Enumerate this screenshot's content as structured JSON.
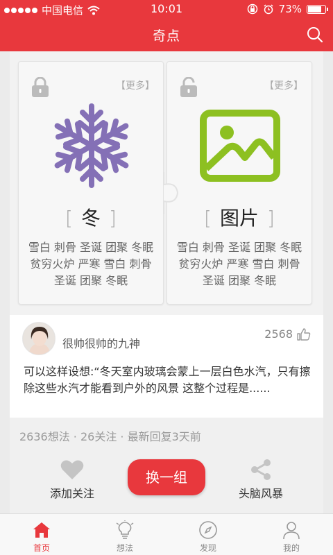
{
  "status_bar": {
    "carrier": "中国电信",
    "time": "10:01",
    "battery": "73%"
  },
  "header": {
    "title": "奇点"
  },
  "cards": [
    {
      "name": "冬",
      "more": "【更多】",
      "tags": "雪白 刺骨 圣诞 团聚 冬眠 贫穷火炉 严寒 雪白 刺骨 圣诞 团聚 冬眠",
      "icon": "snowflake-icon",
      "locked": true,
      "color": "#8470b6"
    },
    {
      "name": "图片",
      "more": "【更多】",
      "tags": "雪白 刺骨 圣诞 团聚 冬眠 贫穷火炉 严寒 雪白 刺骨 圣诞 团聚 冬眠",
      "icon": "picture-icon",
      "locked": false,
      "color": "#8dc021"
    }
  ],
  "bracket_open": "[",
  "bracket_close": "]",
  "post": {
    "author": "很帅很帅的九神",
    "likes": "2568",
    "text": "可以这样设想:“冬天室内玻璃会蒙上一层白色水汽，只有擦除这些水汽才能看到户外的风景 这整个过程是......"
  },
  "stats": {
    "line": "2636想法 · 26关注 · 最新回复3天前"
  },
  "actions": {
    "follow": "添加关注",
    "swap": "换一组",
    "brainstorm": "头脑风暴"
  },
  "tabs": [
    {
      "label": "首页",
      "icon": "home-icon",
      "active": true
    },
    {
      "label": "想法",
      "icon": "lightbulb-icon",
      "active": false
    },
    {
      "label": "发现",
      "icon": "compass-icon",
      "active": false
    },
    {
      "label": "我的",
      "icon": "person-icon",
      "active": false
    }
  ],
  "colors": {
    "brand": "#e8383d",
    "snowflake": "#8470b6",
    "picture": "#8dc021"
  }
}
